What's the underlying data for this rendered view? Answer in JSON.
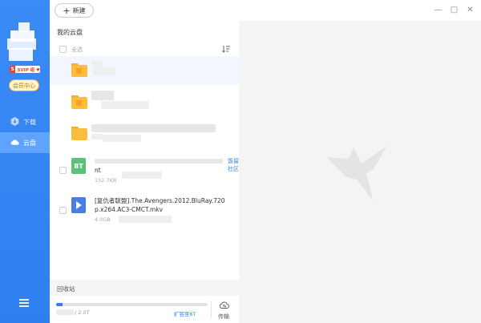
{
  "sidebar": {
    "vip_s": "S",
    "vip_text": "SVIP 组 ♥",
    "member_center": "会员中心",
    "nav": [
      {
        "label": "下载",
        "icon": "download-icon",
        "active": false
      },
      {
        "label": "云盘",
        "icon": "cloud-icon",
        "active": true
      }
    ]
  },
  "toolbar": {
    "new_label": "新建",
    "new_plus": "+",
    "win_min": "—",
    "win_max": "□",
    "win_close": "✕"
  },
  "main": {
    "title": "我的云盘",
    "select_all": "全选",
    "files": [
      {
        "type": "folder",
        "name": "",
        "size": ""
      },
      {
        "type": "folder",
        "name": "",
        "size": ""
      },
      {
        "type": "folder",
        "name": "",
        "size": ""
      },
      {
        "type": "bt",
        "icon_text": "BT",
        "name": "nt",
        "size": "152.7KB",
        "extra": "饭留社区"
      },
      {
        "type": "video",
        "name": "[复仇者联盟].The.Avengers.2012.BluRay.720p.x264.AC3-CMCT.mkv",
        "name_line1": "[复仇者联盟].The.Avengers.2012.BluRay.720",
        "name_line2": "p.x264.AC3-CMCT.mkv",
        "size": "4.0GB"
      }
    ]
  },
  "footer": {
    "recycle_label": "回收站",
    "storage_total": "/ 2.0T",
    "storage_used_fraction": 0.04,
    "expand_label": "扩容至6T",
    "transfer_label": "传输"
  },
  "colors": {
    "accent": "#2f7ff0",
    "sidebar": "#3a8bf5",
    "folder": "#fbbd3a",
    "bt": "#5ac27a",
    "video": "#4a7de8"
  }
}
